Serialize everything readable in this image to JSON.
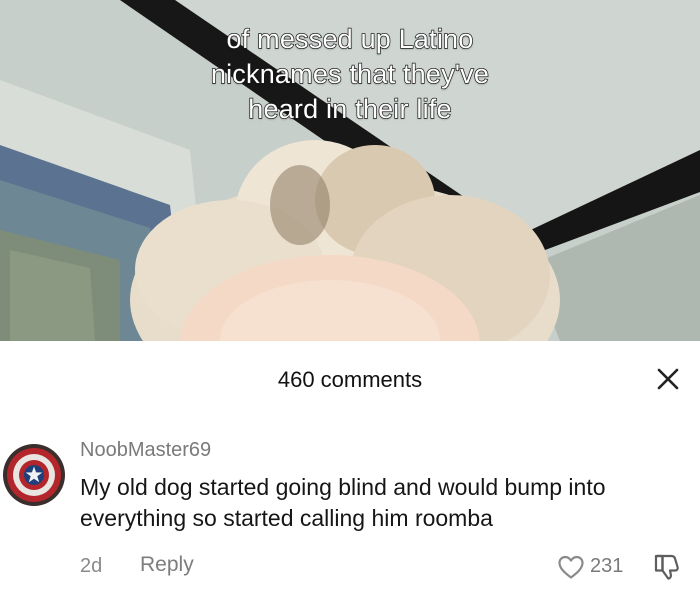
{
  "video": {
    "caption_lines": [
      "of messed up Latino",
      "nicknames that they've",
      "heard in their life"
    ]
  },
  "comments_panel": {
    "count_label": "460 comments",
    "close_icon": "close-icon",
    "comment": {
      "username": "NoobMaster69",
      "avatar_icon": "captain-america-shield-avatar",
      "text": "My old dog started going blind and would bump into everything so started calling him roomba",
      "time": "2d",
      "reply_label": "Reply",
      "like_count": "231",
      "like_icon": "heart-outline-icon",
      "dislike_icon": "thumbs-down-icon"
    }
  },
  "colors": {
    "caption_text": "#ffffff",
    "caption_outline": "#1c1c1c",
    "secondary_text": "#7a7a7a",
    "primary_text": "#161616"
  }
}
